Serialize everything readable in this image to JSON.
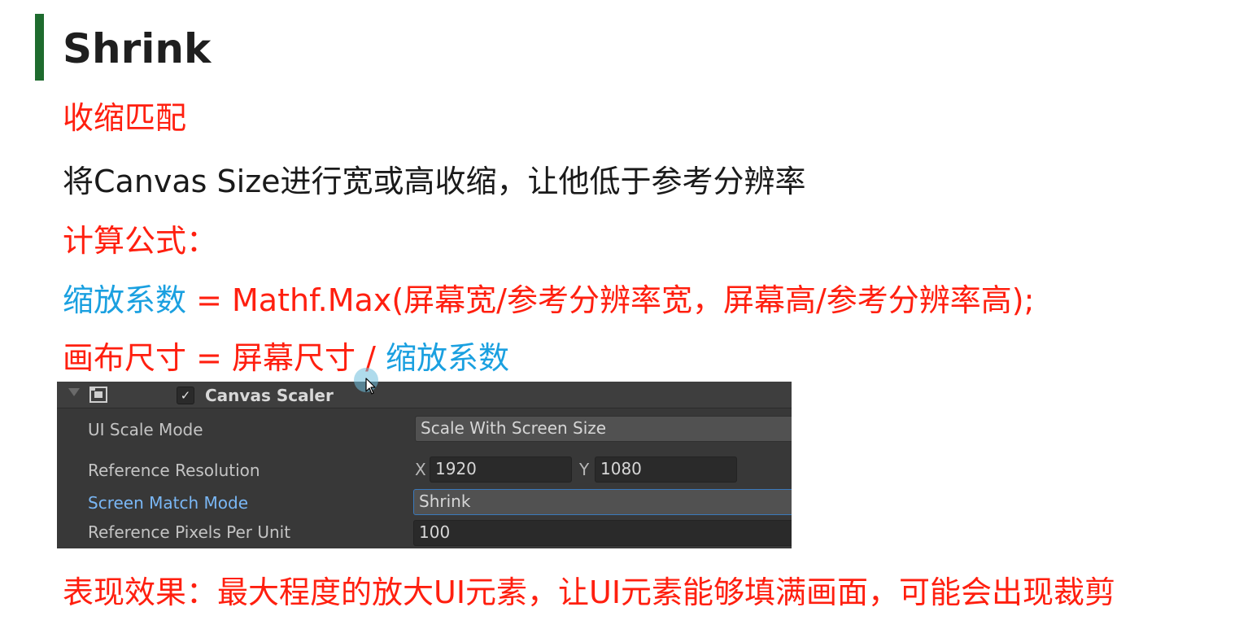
{
  "title": "Shrink",
  "subtitle": "收缩匹配",
  "description": "将Canvas Size进行宽或高收缩，让他低于参考分辨率",
  "formula_heading": "计算公式：",
  "formula1": {
    "name": "缩放系数",
    "expression": " = Mathf.Max(屏幕宽/参考分辨率宽，屏幕高/参考分辨率高);"
  },
  "formula2": {
    "prefix": "画布尺寸 = 屏幕尺寸 / ",
    "factor": "缩放系数"
  },
  "effect": "表现效果：最大程度的放大UI元素，让UI元素能够填满画面，可能会出现裁剪",
  "inspector": {
    "component_name": "Canvas Scaler",
    "enabled_mark": "✓",
    "ui_scale_mode": {
      "label": "UI Scale Mode",
      "value": "Scale With Screen Size"
    },
    "reference_resolution": {
      "label": "Reference Resolution",
      "x_label": "X",
      "x_value": "1920",
      "y_label": "Y",
      "y_value": "1080"
    },
    "screen_match_mode": {
      "label": "Screen Match Mode",
      "value": "Shrink"
    },
    "reference_pixels_per_unit": {
      "label": "Reference Pixels Per Unit",
      "value": "100"
    }
  },
  "colors": {
    "accent_bar": "#1e6b2e",
    "red_text": "#ff1f0f",
    "blue_text": "#1aa0e0",
    "panel_bg": "#383838",
    "highlight_label": "#7ab7f5"
  },
  "icons": [
    "foldout-arrow-icon",
    "canvas-scaler-icon",
    "checkbox-check-icon",
    "mouse-cursor-icon"
  ]
}
